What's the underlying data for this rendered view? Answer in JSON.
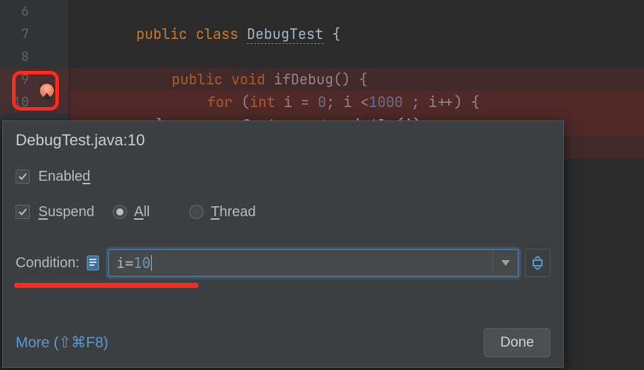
{
  "editor": {
    "lines": [
      "6",
      "7",
      "8",
      "9",
      "10"
    ],
    "code": {
      "l6": {
        "kw1": "public",
        "kw2": "class",
        "cls": "DebugTest",
        "brace": "{"
      },
      "l8": {
        "kw1": "public",
        "kw2": "void",
        "fn": "ifDebug",
        "after": "() {"
      },
      "l9": {
        "for": "for ",
        "open": "(",
        "kw_int": "int ",
        "var": "i = ",
        "zero": "0",
        "rest": "; i <",
        "limit": "1000 ",
        "rest2": "; i++) {"
      },
      "l10": {
        "pre": "System.",
        "out": "out",
        "mid": ".println(i);"
      },
      "l11": "}"
    }
  },
  "popup": {
    "title": "DebugTest.java:10",
    "enabled_label_pre": "Enable",
    "enabled_label_u": "d",
    "suspend_label_pre": "S",
    "suspend_label_rest": "uspend",
    "all_label_u": "A",
    "all_label_rest": "ll",
    "thread_label_u": "T",
    "thread_label_rest": "hread",
    "condition_label": "Condition:",
    "condition_value_pre": "i=",
    "condition_value_num": "10",
    "more_label": "More (⇧⌘F8)",
    "done_label": "Done",
    "enabled_checked": true,
    "suspend_checked": true,
    "scope_selected": "all"
  }
}
